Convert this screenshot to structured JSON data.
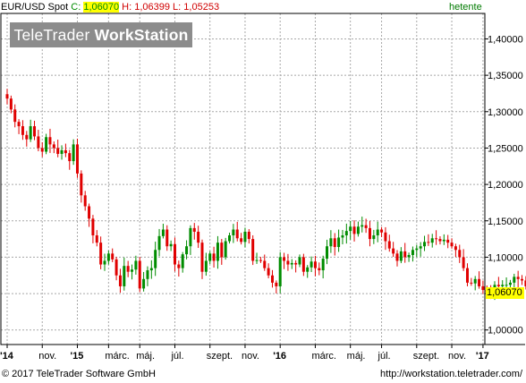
{
  "header": {
    "symbol": "EUR/USD Spot",
    "close_label": "C:",
    "close_value": "1,06070",
    "high_label": "H:",
    "high_value": "1,06399",
    "low_label": "L:",
    "low_value": "1,05253",
    "interval": "hetente"
  },
  "watermark": {
    "part1": "TeleTrader ",
    "part2": "WorkStation"
  },
  "footer": {
    "copyright": "© 2017 TeleTrader Software GmbH",
    "url": "http://workstation.teletrader.com/"
  },
  "last_price_box": "1,06070",
  "colors": {
    "up": "#008c00",
    "down": "#e00000",
    "grid": "#a8a8a8",
    "frame": "#000000",
    "hetente": "#007a00",
    "price_box": "#ffff00"
  },
  "chart_data": {
    "type": "candlestick",
    "interval": "weekly",
    "ylim": [
      0.98,
      1.435
    ],
    "y_ticks": [
      "1,00000",
      "1,05000",
      "1,10000",
      "1,15000",
      "1,20000",
      "1,25000",
      "1,30000",
      "1,35000",
      "1,40000"
    ],
    "y_tick_values": [
      1.0,
      1.05,
      1.1,
      1.15,
      1.2,
      1.25,
      1.3,
      1.35,
      1.4
    ],
    "x_labels": [
      {
        "label": "'14",
        "week": 0,
        "bold": true
      },
      {
        "label": "nov.",
        "week": 9,
        "bold": false
      },
      {
        "label": "'15",
        "week": 18,
        "bold": true
      },
      {
        "label": "márc.",
        "week": 26,
        "bold": false
      },
      {
        "label": "máj.",
        "week": 34,
        "bold": false
      },
      {
        "label": "júl.",
        "week": 43,
        "bold": false
      },
      {
        "label": "szept.",
        "week": 52,
        "bold": false
      },
      {
        "label": "nov.",
        "week": 61,
        "bold": false
      },
      {
        "label": "'16",
        "week": 70,
        "bold": true
      },
      {
        "label": "márc.",
        "week": 79,
        "bold": false
      },
      {
        "label": "máj.",
        "week": 88,
        "bold": false
      },
      {
        "label": "júl.",
        "week": 96,
        "bold": false
      },
      {
        "label": "szept.",
        "week": 105,
        "bold": false
      },
      {
        "label": "nov.",
        "week": 114,
        "bold": false
      },
      {
        "label": "'17",
        "week": 122,
        "bold": true
      }
    ],
    "close": [
      1.318,
      1.303,
      1.286,
      1.28,
      1.268,
      1.262,
      1.28,
      1.266,
      1.25,
      1.245,
      1.265,
      1.255,
      1.25,
      1.242,
      1.247,
      1.243,
      1.232,
      1.255,
      1.215,
      1.185,
      1.17,
      1.153,
      1.13,
      1.12,
      1.09,
      1.095,
      1.105,
      1.097,
      1.075,
      1.06,
      1.088,
      1.08,
      1.083,
      1.095,
      1.057,
      1.07,
      1.082,
      1.085,
      1.11,
      1.129,
      1.138,
      1.115,
      1.118,
      1.09,
      1.085,
      1.104,
      1.115,
      1.14,
      1.135,
      1.12,
      1.08,
      1.095,
      1.105,
      1.095,
      1.12,
      1.1,
      1.122,
      1.13,
      1.138,
      1.126,
      1.121,
      1.135,
      1.125,
      1.095,
      1.096,
      1.095,
      1.085,
      1.075,
      1.065,
      1.06,
      1.1,
      1.095,
      1.09,
      1.092,
      1.09,
      1.1,
      1.08,
      1.086,
      1.094,
      1.085,
      1.082,
      1.098,
      1.115,
      1.126,
      1.114,
      1.127,
      1.13,
      1.136,
      1.142,
      1.132,
      1.142,
      1.144,
      1.14,
      1.125,
      1.13,
      1.138,
      1.134,
      1.122,
      1.112,
      1.105,
      1.095,
      1.108,
      1.1,
      1.103,
      1.11,
      1.112,
      1.115,
      1.121,
      1.12,
      1.126,
      1.125,
      1.122,
      1.124,
      1.12,
      1.115,
      1.11,
      1.1,
      1.085,
      1.065,
      1.064,
      1.07,
      1.06,
      1.055,
      1.052,
      1.05,
      1.062,
      1.06,
      1.062,
      1.062,
      1.065,
      1.073,
      1.07,
      1.068,
      1.06,
      1.055,
      1.062,
      1.061
    ],
    "candles_note": "price moves 1,32 (2014) to 1,06 (2017); last 1,06070"
  }
}
